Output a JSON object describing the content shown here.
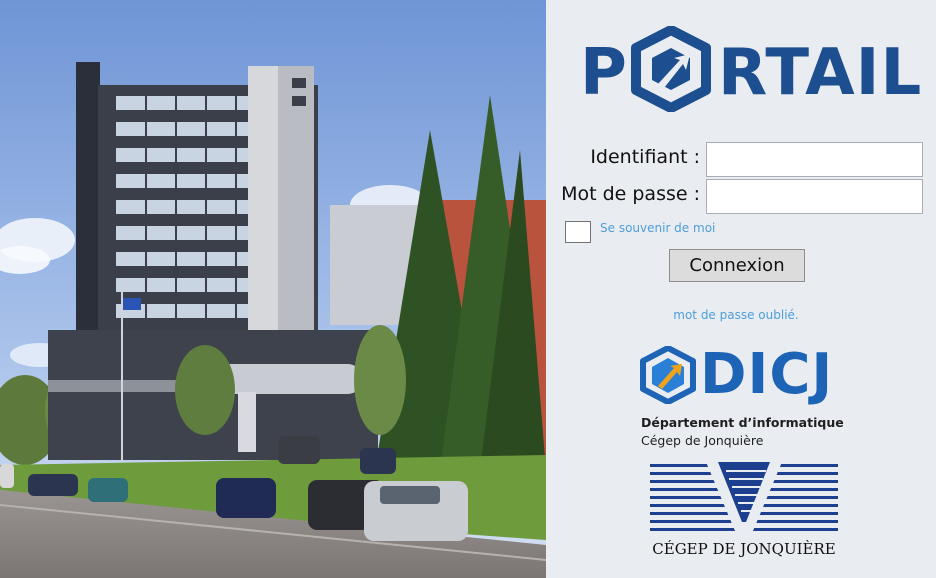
{
  "photo": {
    "alt": "Cégep de Jonquière campus building"
  },
  "logo": {
    "text_before": "P",
    "text_after": "RTAIL",
    "color": "#1d4e8f"
  },
  "login": {
    "identifiant_label": "Identifiant :",
    "identifiant_value": "",
    "password_label": "Mot de passe :",
    "password_value": "",
    "remember_label": "Se souvenir de moi",
    "remember_checked": false,
    "submit_label": "Connexion",
    "forgot_link": "mot de passe oublié."
  },
  "dicj": {
    "letters": "DICJ",
    "department": "Département d’informatique",
    "college": "Cégep de Jonquière",
    "color": "#1d63b6"
  },
  "cegep": {
    "caption": "CÉGEP DE JONQUIÈRE"
  }
}
